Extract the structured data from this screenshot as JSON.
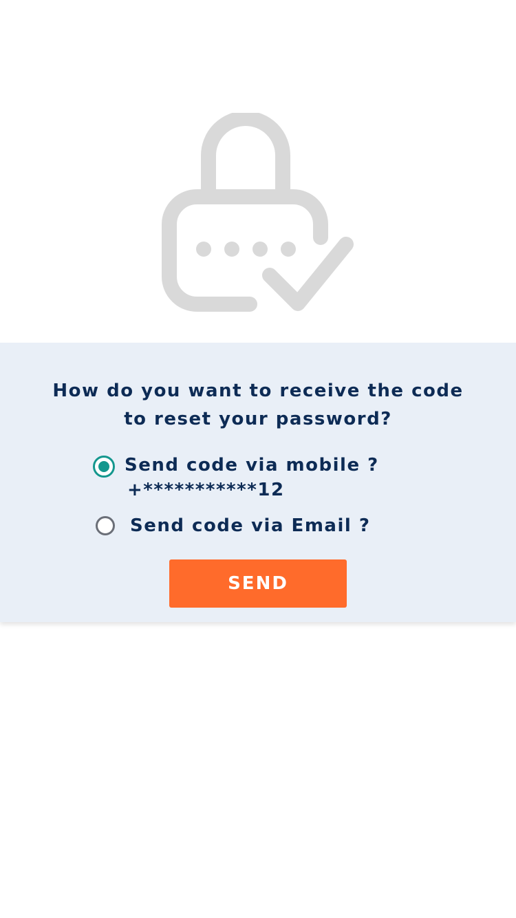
{
  "hero": {
    "icon": "lock-password-check-icon",
    "icon_color": "#d9d9d9"
  },
  "prompt": {
    "question": "How do you want to receive the code to reset your password?"
  },
  "options": [
    {
      "label": "Send code via mobile ?",
      "detail": "+***********12",
      "selected": true
    },
    {
      "label": "Send code via Email ?",
      "selected": false
    }
  ],
  "actions": {
    "send_label": "SEND"
  },
  "colors": {
    "text": "#0d2b55",
    "card_background": "#e9eff7",
    "radio_accent": "#14978e",
    "button": "#ff6b2b"
  }
}
